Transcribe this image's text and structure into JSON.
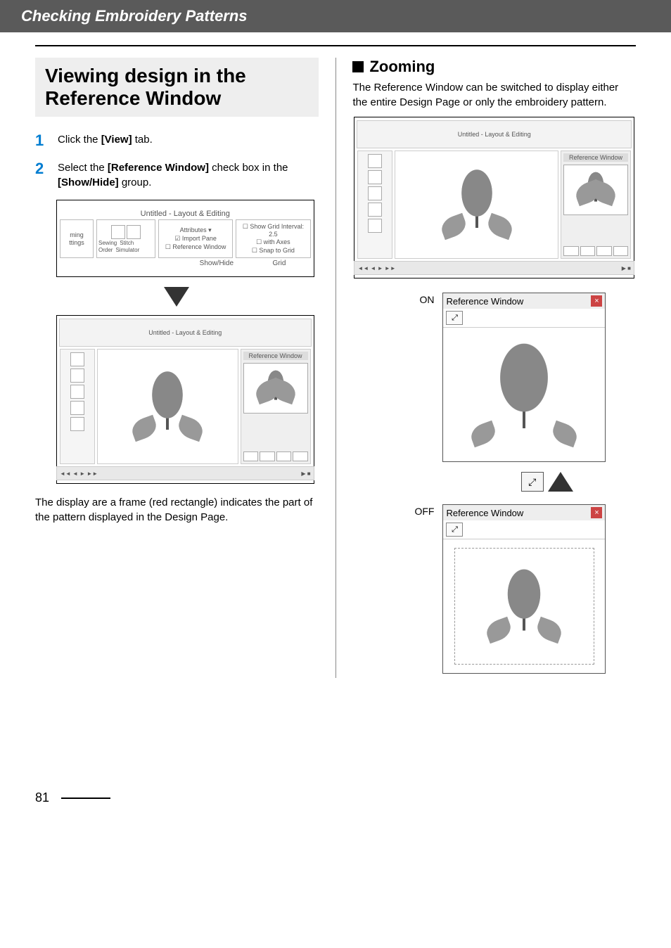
{
  "header": {
    "title": "Checking Embroidery Patterns"
  },
  "left": {
    "sectionTitle1": "Viewing design in the",
    "sectionTitle2": "Reference Window",
    "step1_num": "1",
    "step1_pre": "Click the ",
    "step1_bold": "[View]",
    "step1_post": " tab.",
    "step2_num": "2",
    "step2_pre": "Select the ",
    "step2_bold1": "[Reference Window]",
    "step2_mid": " check box in the ",
    "step2_bold2": "[Show/Hide]",
    "step2_post": " group.",
    "ribbon_caption": "Untitled - Layout & Editing",
    "ribbon_cell1_l1": "ming",
    "ribbon_cell1_l2": "ttings",
    "ribbon_cell2_l1": "Sewing",
    "ribbon_cell2_l2": "Order",
    "ribbon_cell2_l3": "Stitch",
    "ribbon_cell2_l4": "Simulator",
    "ribbon_cell3_l1": "Attributes ▾",
    "ribbon_cell3_l2": "☑ Import Pane",
    "ribbon_cell3_l3": "☐ Reference Window",
    "ribbon_cell4_l1": "☐ Show Grid   Interval: 2.5",
    "ribbon_cell4_l2": "☐ with Axes",
    "ribbon_cell4_l3": "☐ Snap to Grid",
    "ribbon_bottom1": "Show/Hide",
    "ribbon_bottom2": "Grid",
    "app_window_title": "Untitled - Layout & Editing",
    "refpanel_title": "Reference Window",
    "afterFig": "The display are a frame (red rectangle) indicates the part of the pattern displayed in the Design Page."
  },
  "right": {
    "subheading": "Zooming",
    "para": "The Reference Window can be switched to display either the entire Design Page or only the embroidery pattern.",
    "app_window_title": "Untitled - Layout & Editing",
    "refpanel_title": "Reference Window",
    "on_label": "ON",
    "off_label": "OFF",
    "ref_window_title": "Reference Window",
    "zoom_btn": "⤢"
  },
  "page_number": "81"
}
